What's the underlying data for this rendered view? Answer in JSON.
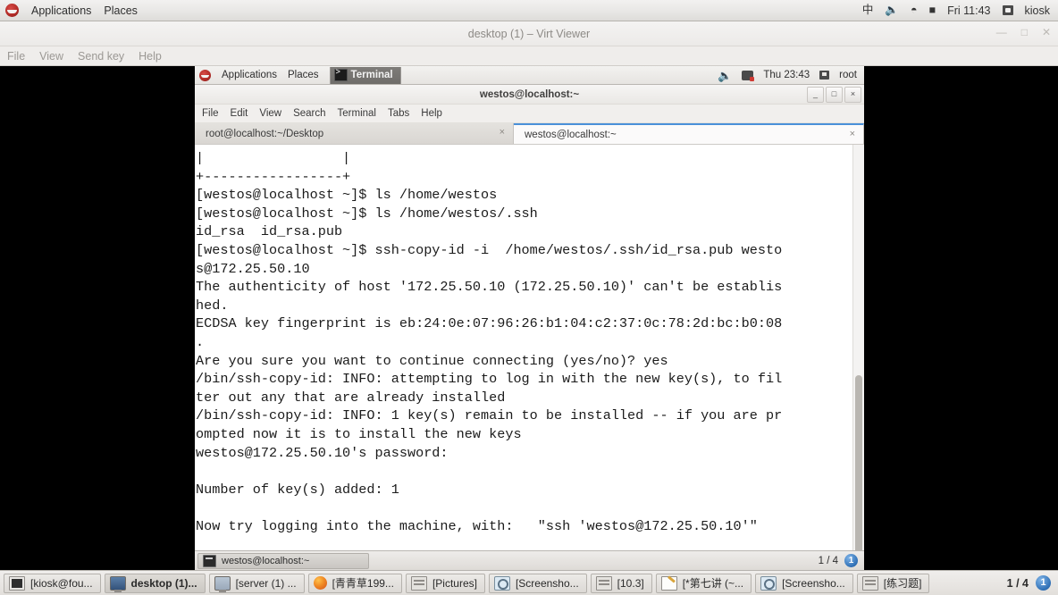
{
  "host_panel": {
    "logo_icon": "redhat-logo-icon",
    "menus": [
      "Applications",
      "Places"
    ],
    "tray": {
      "input_method": "中",
      "volume_icon": "volume-icon",
      "network_icon": "wifi-icon",
      "battery_icon": "battery-icon",
      "clock": "Fri 11:43",
      "user_icon": "user-icon",
      "user": "kiosk"
    }
  },
  "virt_viewer": {
    "title": "desktop (1) – Virt Viewer",
    "window_buttons": [
      "minimize",
      "maximize",
      "close"
    ],
    "menus": [
      "File",
      "View",
      "Send key",
      "Help"
    ]
  },
  "guest_panel": {
    "logo_icon": "redhat-logo-icon",
    "menus": [
      "Applications",
      "Places"
    ],
    "active_task": "Terminal",
    "active_task_icon": "terminal-icon",
    "tray": {
      "volume_icon": "volume-icon",
      "network_icon": "network-disconnected-icon",
      "clock": "Thu 23:43",
      "user_icon": "user-icon",
      "user": "root"
    }
  },
  "terminal_window": {
    "title": "westos@localhost:~",
    "window_buttons": {
      "minimize": "_",
      "maximize": "□",
      "close": "×"
    },
    "menus": [
      "File",
      "Edit",
      "View",
      "Search",
      "Terminal",
      "Tabs",
      "Help"
    ],
    "tabs": [
      {
        "label": "root@localhost:~/Desktop",
        "active": false,
        "close": "×"
      },
      {
        "label": "westos@localhost:~",
        "active": true,
        "close": "×"
      }
    ],
    "content": "|                 |\n+-----------------+\n[westos@localhost ~]$ ls /home/westos\n[westos@localhost ~]$ ls /home/westos/.ssh\nid_rsa  id_rsa.pub\n[westos@localhost ~]$ ssh-copy-id -i  /home/westos/.ssh/id_rsa.pub westo\ns@172.25.50.10\nThe authenticity of host '172.25.50.10 (172.25.50.10)' can't be establis\nhed.\nECDSA key fingerprint is eb:24:0e:07:96:26:b1:04:c2:37:0c:78:2d:bc:b0:08\n.\nAre you sure you want to continue connecting (yes/no)? yes\n/bin/ssh-copy-id: INFO: attempting to log in with the new key(s), to fil\nter out any that are already installed\n/bin/ssh-copy-id: INFO: 1 key(s) remain to be installed -- if you are pr\nompted now it is to install the new keys\nwestos@172.25.50.10's password:\n\nNumber of key(s) added: 1\n\nNow try logging into the machine, with:   \"ssh 'westos@172.25.50.10'\""
  },
  "guest_taskbar": {
    "items": [
      {
        "label": "westos@localhost:~",
        "icon": "terminal-icon"
      }
    ],
    "workspace": "1 / 4",
    "workspace_badge": "1"
  },
  "host_taskbar": {
    "items": [
      {
        "label": "[kiosk@fou...",
        "icon": "terminal-icon",
        "active": false
      },
      {
        "label": "desktop (1)...",
        "icon": "display-icon",
        "active": true
      },
      {
        "label": "[server (1) ...",
        "icon": "display-icon-dim",
        "active": false
      },
      {
        "label": "[青青草199...",
        "icon": "firefox-icon",
        "active": false
      },
      {
        "label": "[Pictures]",
        "icon": "folder-icon",
        "active": false
      },
      {
        "label": "[Screensho...",
        "icon": "screenshot-icon",
        "active": false
      },
      {
        "label": "[10.3]",
        "icon": "folder-icon",
        "active": false
      },
      {
        "label": "[*第七讲 (~...",
        "icon": "notes-icon",
        "active": false
      },
      {
        "label": "[Screensho...",
        "icon": "screenshot-icon",
        "active": false
      },
      {
        "label": "[练习题]",
        "icon": "folder-icon",
        "active": false
      }
    ],
    "workspace": "1 / 4",
    "workspace_badge": "1"
  },
  "colors": {
    "accent_blue": "#4a90d9",
    "panel_bg": "#e8e7e5",
    "terminal_bg": "#ffffff",
    "terminal_fg": "#1b1b1b",
    "redhat_red": "#b02a26"
  }
}
